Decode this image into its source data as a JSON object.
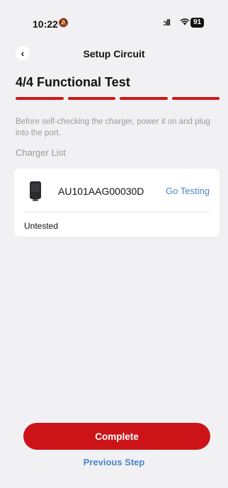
{
  "status_bar": {
    "time": "10:22",
    "bell_icon": "bell-slash-icon",
    "signal_icon": "signal-icon",
    "wifi_icon": "wifi-icon",
    "battery_level": "91"
  },
  "nav": {
    "title": "Setup Circuit",
    "back_icon": "chevron-left-icon"
  },
  "step": {
    "title": "4/4 Functional Test",
    "progress_total": 4,
    "progress_done": 4,
    "accent_color": "#cc1818"
  },
  "hint": "Before self-checking the charger, power it on and plug into the port.",
  "list_title": "Charger List",
  "chargers": [
    {
      "id": "AU101AAG00030D",
      "action": "Go Testing",
      "status": "Untested",
      "icon": "charger-icon"
    }
  ],
  "footer": {
    "primary_label": "Complete",
    "secondary_label": "Previous Step",
    "primary_color": "#cc1418",
    "link_color": "#4a86c8"
  }
}
